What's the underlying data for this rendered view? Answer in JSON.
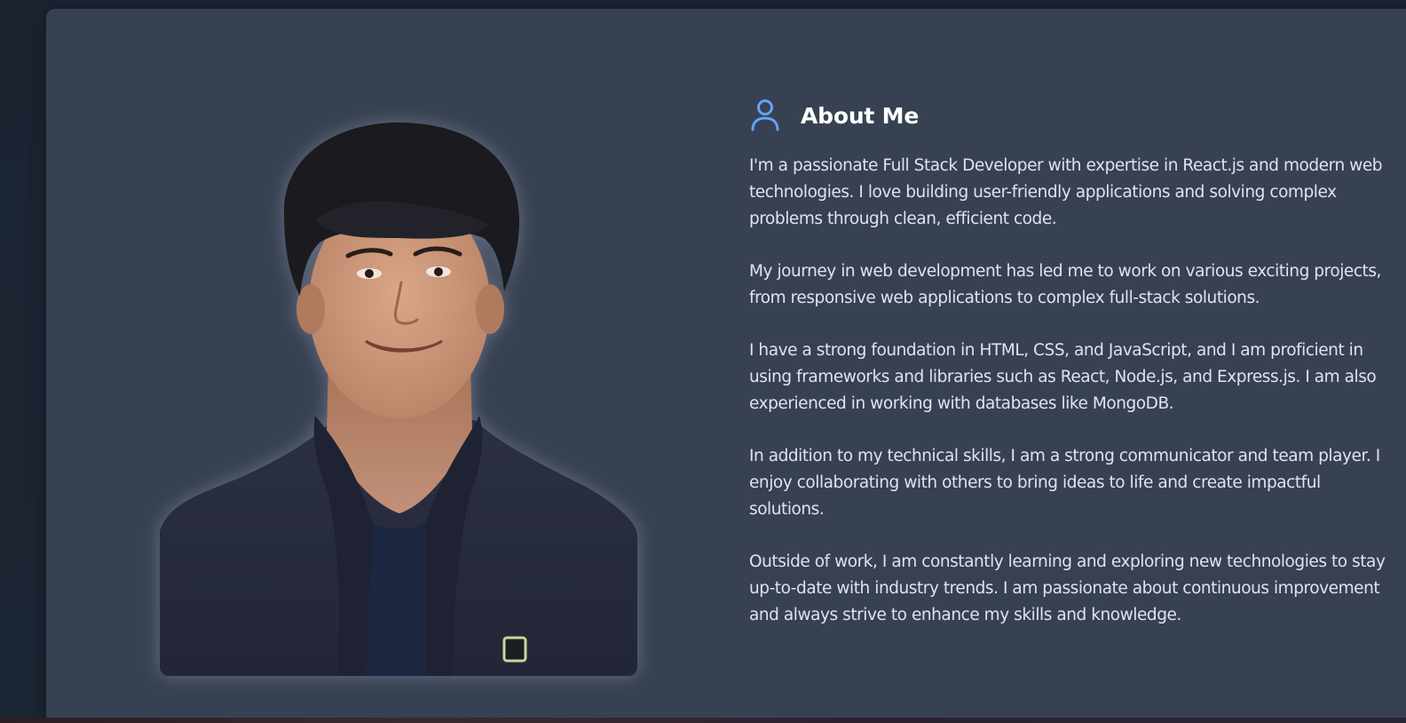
{
  "about": {
    "heading": "About Me",
    "heading_icon": "user-icon",
    "accent_color": "#60a5fa",
    "paragraphs": [
      "I'm a passionate Full Stack Developer with expertise in React.js and modern web technologies. I love building user-friendly applications and solving complex problems through clean, efficient code.",
      "My journey in web development has led me to work on various exciting projects, from responsive web applications to complex full-stack solutions.",
      "I have a strong foundation in HTML, CSS, and JavaScript, and I am proficient in using frameworks and libraries such as React, Node.js, and Express.js. I am also experienced in working with databases like MongoDB.",
      "In addition to my technical skills, I am a strong communicator and team player. I enjoy collaborating with others to bring ideas to life and create impactful solutions.",
      "Outside of work, I am constantly learning and exploring new technologies to stay up-to-date with industry trends. I am passionate about continuous improvement and always strive to enhance my skills and knowledge."
    ]
  },
  "colors": {
    "card_background": "#374151",
    "page_background": "#1b2331",
    "heading_text": "#ffffff",
    "body_text": "#dfe4ec"
  }
}
